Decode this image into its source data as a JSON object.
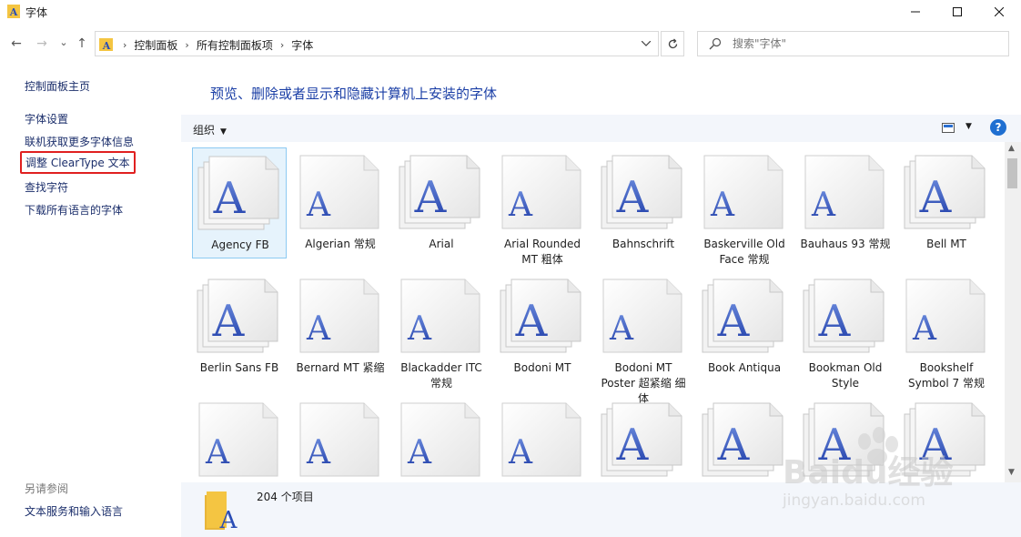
{
  "window": {
    "title": "字体",
    "min_label": "—",
    "max_label": "☐",
    "close_label": "✕"
  },
  "nav": {
    "back": "←",
    "forward": "→",
    "recent": "⌄",
    "up": "↑"
  },
  "address": {
    "crumbs": [
      "控制面板",
      "所有控制面板项",
      "字体"
    ],
    "separator": "›"
  },
  "search": {
    "placeholder": "搜索\"字体\""
  },
  "sidebar": {
    "home": "控制面板主页",
    "links": [
      "字体设置",
      "联机获取更多字体信息",
      "调整 ClearType 文本",
      "查找字符",
      "下载所有语言的字体"
    ],
    "see_also_heading": "另请参阅",
    "see_also_links": [
      "文本服务和输入语言"
    ]
  },
  "main": {
    "heading": "预览、删除或者显示和隐藏计算机上安装的字体",
    "organize_label": "组织",
    "help_label": "?"
  },
  "fonts": [
    {
      "name": "Agency FB",
      "stacked": true
    },
    {
      "name": "Algerian 常规",
      "stacked": false
    },
    {
      "name": "Arial",
      "stacked": true
    },
    {
      "name": "Arial Rounded MT 粗体",
      "stacked": false
    },
    {
      "name": "Bahnschrift",
      "stacked": true
    },
    {
      "name": "Baskerville Old Face 常规",
      "stacked": false
    },
    {
      "name": "Bauhaus 93 常规",
      "stacked": false
    },
    {
      "name": "Bell MT",
      "stacked": true
    },
    {
      "name": "Berlin Sans FB",
      "stacked": true
    },
    {
      "name": "Bernard MT 紧缩",
      "stacked": false
    },
    {
      "name": "Blackadder ITC 常规",
      "stacked": false
    },
    {
      "name": "Bodoni MT",
      "stacked": true
    },
    {
      "name": "Bodoni MT Poster 超紧缩 细体",
      "stacked": false
    },
    {
      "name": "Book Antiqua",
      "stacked": true
    },
    {
      "name": "Bookman Old Style",
      "stacked": true
    },
    {
      "name": "Bookshelf Symbol 7 常规",
      "stacked": false
    },
    {
      "name": "",
      "stacked": false
    },
    {
      "name": "",
      "stacked": false
    },
    {
      "name": "",
      "stacked": false
    },
    {
      "name": "",
      "stacked": false
    },
    {
      "name": "",
      "stacked": true
    },
    {
      "name": "",
      "stacked": true
    },
    {
      "name": "",
      "stacked": true
    },
    {
      "name": "",
      "stacked": true
    }
  ],
  "selected_index": 0,
  "status": {
    "item_count": "204 个项目"
  },
  "watermark": {
    "brand": "Baidu经验",
    "url": "jingyan.baidu.com"
  },
  "colors": {
    "accent_blue": "#1b3fa6",
    "link": "#1b2e6b",
    "highlight_red": "#e02020",
    "pane_bg": "#f3f6fb"
  }
}
